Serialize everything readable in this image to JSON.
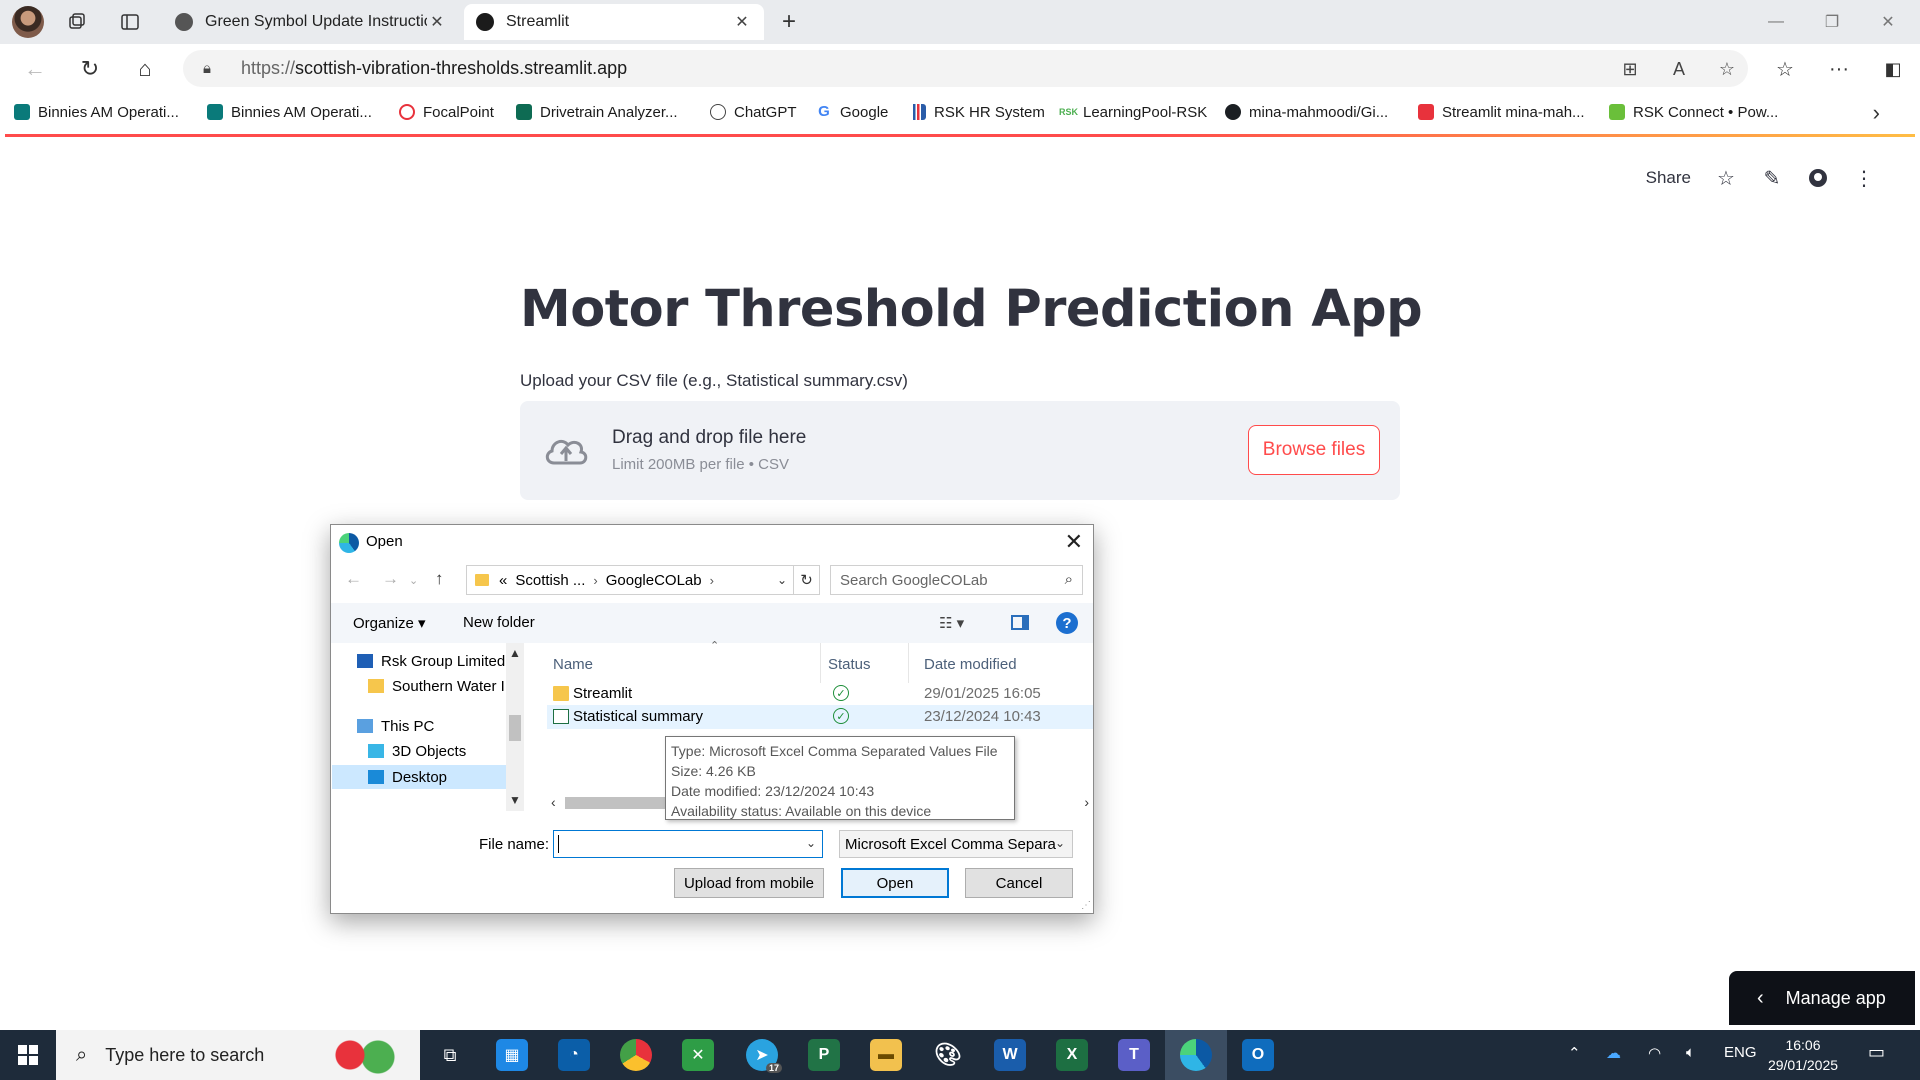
{
  "browser": {
    "tabs": [
      {
        "title": "Green Symbol Update Instruction"
      },
      {
        "title": "Streamlit"
      }
    ],
    "url_proto": "https://",
    "url_host": "scottish-vibration-thresholds.streamlit.app",
    "bookmarks": [
      {
        "label": "Binnies AM Operati...",
        "color": "#0a7a7a"
      },
      {
        "label": "Binnies AM Operati...",
        "color": "#0a7a7a"
      },
      {
        "label": "FocalPoint",
        "color": "#e8323c"
      },
      {
        "label": "Drivetrain Analyzer...",
        "color": "#0e6b53"
      },
      {
        "label": "ChatGPT",
        "color": "#444444"
      },
      {
        "label": "Google",
        "color": "#4285f4"
      },
      {
        "label": "RSK HR System",
        "color": "#2a5ca8"
      },
      {
        "label": "LearningPool-RSK",
        "color": "#4caf50"
      },
      {
        "label": "mina-mahmoodi/Gi...",
        "color": "#1b1f23"
      },
      {
        "label": "Streamlit mina-mah...",
        "color": "#e8323c"
      },
      {
        "label": "RSK Connect • Pow...",
        "color": "#6abf3a"
      }
    ]
  },
  "streamlit": {
    "toolbar": {
      "share": "Share"
    },
    "title": "Motor Threshold Prediction App",
    "upload_label": "Upload your CSV file (e.g., Statistical summary.csv)",
    "dropzone_title": "Drag and drop file here",
    "dropzone_sub": "Limit 200MB per file • CSV",
    "browse_label": "Browse files",
    "manage_app": "Manage app"
  },
  "dialog": {
    "title": "Open",
    "path": [
      "Scottish ...",
      "GoogleCOLab"
    ],
    "path_prefix": "«",
    "search_placeholder": "Search GoogleCOLab",
    "organize": "Organize",
    "new_folder": "New folder",
    "tree": [
      {
        "label": "Rsk Group Limited"
      },
      {
        "label": "Southern Water I"
      },
      {
        "label": "This PC"
      },
      {
        "label": "3D Objects"
      },
      {
        "label": "Desktop"
      }
    ],
    "columns": {
      "name": "Name",
      "status": "Status",
      "date": "Date modified"
    },
    "files": [
      {
        "name": "Streamlit",
        "date": "29/01/2025 16:05"
      },
      {
        "name": "Statistical summary",
        "date": "23/12/2024 10:43"
      }
    ],
    "tooltip": [
      "Type: Microsoft Excel Comma Separated Values File",
      "Size: 4.26 KB",
      "Date modified: 23/12/2024 10:43",
      "Availability status: Available on this device"
    ],
    "file_name_label": "File name:",
    "file_name_value": "",
    "file_type": "Microsoft Excel Comma Separa",
    "buttons": {
      "upload_mobile": "Upload from mobile",
      "open": "Open",
      "cancel": "Cancel"
    }
  },
  "taskbar": {
    "search_placeholder": "Type here to search",
    "lang": "ENG",
    "time": "16:06",
    "date": "29/01/2025",
    "telegram_badge": "17"
  }
}
